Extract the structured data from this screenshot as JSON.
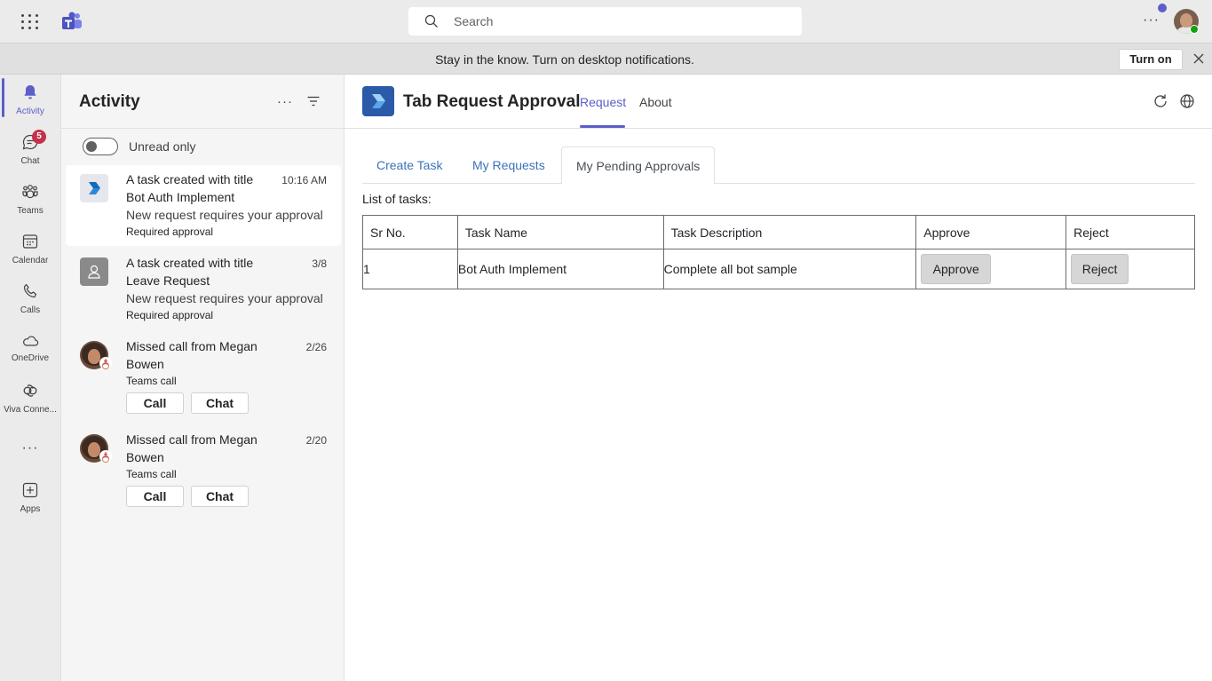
{
  "topbar": {
    "search_placeholder": "Search",
    "more": "···"
  },
  "banner": {
    "message": "Stay in the know. Turn on desktop notifications.",
    "turn_on_label": "Turn on"
  },
  "rail": {
    "items": [
      {
        "label": "Activity",
        "icon": "bell-icon",
        "active": true
      },
      {
        "label": "Chat",
        "icon": "chat-icon",
        "badge": "5"
      },
      {
        "label": "Teams",
        "icon": "teams-icon"
      },
      {
        "label": "Calendar",
        "icon": "calendar-icon"
      },
      {
        "label": "Calls",
        "icon": "phone-icon"
      },
      {
        "label": "OneDrive",
        "icon": "cloud-icon"
      },
      {
        "label": "Viva Conne...",
        "icon": "viva-connections-icon"
      },
      {
        "label": "···",
        "icon": "more-icon"
      },
      {
        "label": "Apps",
        "icon": "add-app-icon"
      }
    ]
  },
  "activity": {
    "title": "Activity",
    "more": "···",
    "unread_only_label": "Unread only",
    "items": [
      {
        "line1": "A task created with title",
        "line2": "Bot Auth Implement",
        "line3": "New request requires your approval",
        "line4": "Required approval",
        "time": "10:16 AM"
      },
      {
        "line1": "A task created with title",
        "line2": "Leave Request",
        "line3": "New request requires your approval",
        "line4": "Required approval",
        "time": "3/8"
      },
      {
        "line1": "Missed call from Megan",
        "line2": "Bowen",
        "line3": "Teams call",
        "time": "2/26",
        "call_label": "Call",
        "chat_label": "Chat"
      },
      {
        "line1": "Missed call from Megan",
        "line2": "Bowen",
        "line3": "Teams call",
        "time": "2/20",
        "call_label": "Call",
        "chat_label": "Chat"
      }
    ]
  },
  "app": {
    "name": "Tab Request Approval",
    "tabs": [
      {
        "label": "Request",
        "active": true
      },
      {
        "label": "About",
        "active": false
      }
    ]
  },
  "content": {
    "tabs": [
      {
        "label": "Create Task",
        "active": false
      },
      {
        "label": "My Requests",
        "active": false
      },
      {
        "label": "My Pending Approvals",
        "active": true
      }
    ],
    "list_label": "List of tasks:",
    "table": {
      "headers": [
        "Sr No.",
        "Task Name",
        "Task Description",
        "Approve",
        "Reject"
      ],
      "rows": [
        {
          "sr_no": "1",
          "task_name": "Bot Auth Implement",
          "task_description": "Complete all bot sample",
          "approve_label": "Approve",
          "reject_label": "Reject"
        }
      ]
    }
  },
  "colors": {
    "accent": "#5b5fc7",
    "badge": "#c4314b",
    "presence": "#13a10e",
    "link_tab": "#3b73b9"
  }
}
